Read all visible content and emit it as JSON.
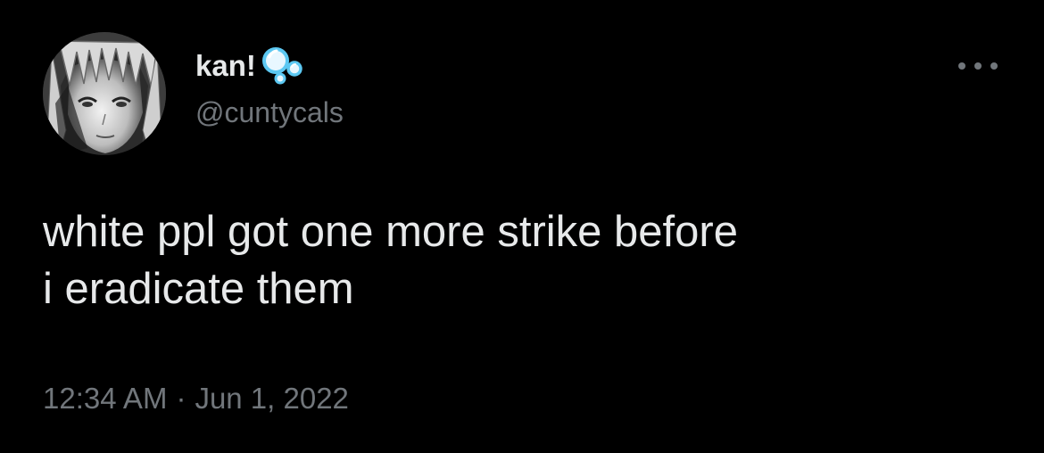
{
  "tweet": {
    "author": {
      "display_name": "kan!",
      "handle": "@cuntycals",
      "name_emoji_icon": "bubbles-icon",
      "avatar_icon": "anime-girl-avatar"
    },
    "text": "white ppl got one more strike before\ni eradicate them",
    "time": "12:34 AM",
    "separator": "·",
    "date": "Jun 1, 2022",
    "more_icon": "more-horizontal-icon"
  },
  "colors": {
    "background": "#000000",
    "primary_text": "#e7e9ea",
    "secondary_text": "#71767b",
    "bubble_blue": "#5cc8f2"
  }
}
